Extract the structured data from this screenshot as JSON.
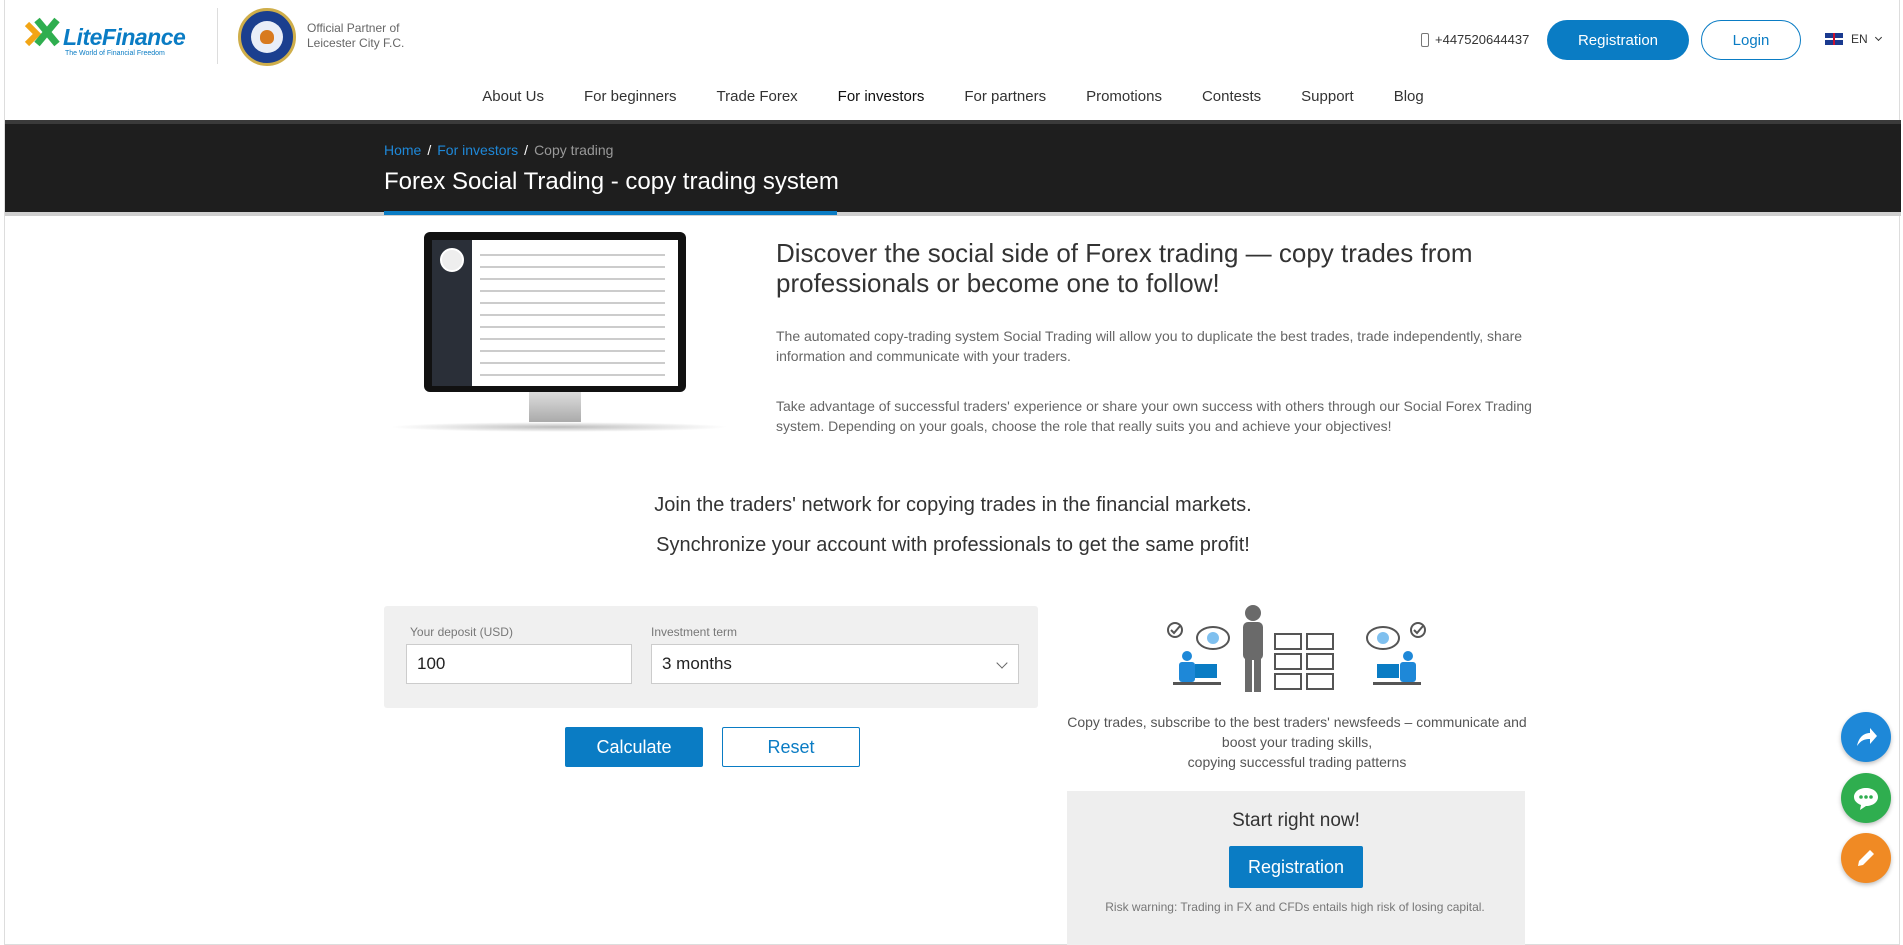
{
  "header": {
    "logo_text": "LiteFinance",
    "logo_tagline": "The World of Financial Freedom",
    "partner_line1": "Official Partner of",
    "partner_line2": "Leicester City F.C.",
    "phone": "+447520644437",
    "registration_label": "Registration",
    "login_label": "Login",
    "language": "EN"
  },
  "nav": {
    "items": [
      {
        "label": "About Us"
      },
      {
        "label": "For beginners"
      },
      {
        "label": "Trade Forex"
      },
      {
        "label": "For investors"
      },
      {
        "label": "For partners"
      },
      {
        "label": "Promotions"
      },
      {
        "label": "Contests"
      },
      {
        "label": "Support"
      },
      {
        "label": "Blog"
      }
    ],
    "active": "For investors"
  },
  "breadcrumb": {
    "home": "Home",
    "investors": "For investors",
    "current": "Copy trading",
    "separator": "/"
  },
  "page_title": "Forex Social Trading - copy trading system",
  "hero": {
    "heading": "Discover the social side of Forex trading — copy trades from professionals or become one to follow!",
    "paragraph1": "The automated copy-trading system Social Trading will allow you to duplicate the best trades, trade independently, share information and communicate with your traders.",
    "paragraph2": "Take advantage of successful traders' experience or share your own success with others through our Social Forex Trading system. Depending on your goals, choose the role that really suits you and achieve your objectives!"
  },
  "tagline": {
    "line1": "Join the traders' network for copying trades in the financial markets.",
    "line2": "Synchronize your account with professionals to get the same profit!"
  },
  "calculator": {
    "deposit_label": "Your deposit (USD)",
    "deposit_value": "100",
    "term_label": "Investment term",
    "term_value": "3 months",
    "calculate_label": "Calculate",
    "reset_label": "Reset"
  },
  "side": {
    "copy_line1": "Copy trades, subscribe to the best traders' newsfeeds – communicate and boost your trading skills,",
    "copy_line2": "copying successful trading patterns",
    "cta_heading": "Start right now!",
    "cta_button": "Registration",
    "risk_warning": "Risk warning: Trading in FX and CFDs entails high risk of losing capital."
  },
  "colors": {
    "accent": "#0a7cc4",
    "banner": "#1e1e1e",
    "share": "#1e88d8",
    "chat": "#2fae4f",
    "edit": "#f08a24"
  },
  "icons": [
    "logo-mark-icon",
    "leicester-crest-icon",
    "phone-icon",
    "uk-flag-icon",
    "chevron-down-icon",
    "share-icon",
    "chat-icon",
    "pencil-icon"
  ]
}
